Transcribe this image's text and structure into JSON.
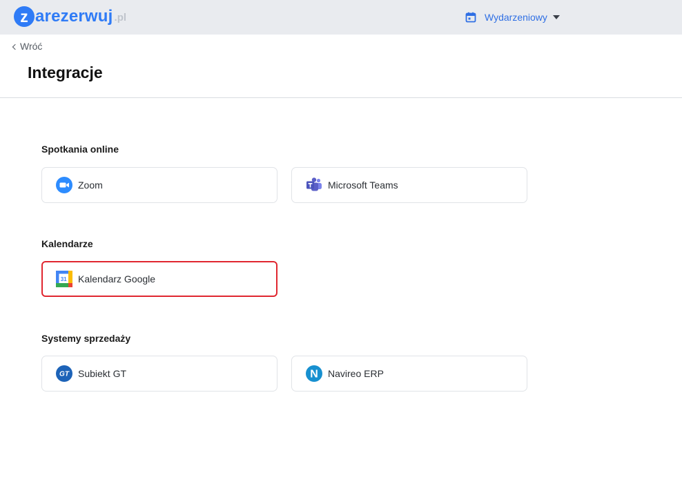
{
  "header": {
    "logo": {
      "initial": "z",
      "text": "arezerwuj",
      "tld": ".pl"
    },
    "view_selector": {
      "label": "Wydarzeniowy",
      "icon": "calendar-icon"
    }
  },
  "nav": {
    "back_label": "Wróć"
  },
  "page": {
    "title": "Integracje"
  },
  "sections": [
    {
      "title": "Spotkania online",
      "items": [
        {
          "label": "Zoom",
          "icon": "zoom-icon"
        },
        {
          "label": "Microsoft Teams",
          "icon": "microsoft-teams-icon"
        }
      ]
    },
    {
      "title": "Kalendarze",
      "items": [
        {
          "label": "Kalendarz Google",
          "icon": "google-calendar-icon",
          "calendar_day": "31"
        }
      ]
    },
    {
      "title": "Systemy sprzedaży",
      "items": [
        {
          "label": "Subiekt GT",
          "icon": "subiekt-gt-icon",
          "badge": "GT"
        },
        {
          "label": "Navireo ERP",
          "icon": "navireo-icon",
          "badge": "N"
        }
      ]
    }
  ],
  "colors": {
    "brand": "#2f7bf6",
    "highlight": "#e0262f",
    "zoom": "#2d8cff",
    "teams": "#5b5fc7",
    "subiekt": "#1d63b8",
    "navireo": "#1790d0"
  }
}
